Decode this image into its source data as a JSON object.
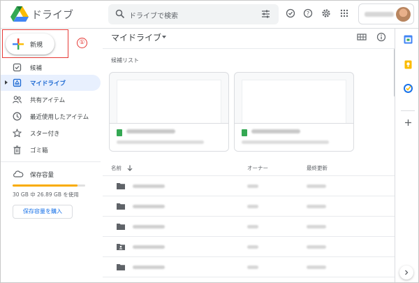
{
  "app": {
    "title": "ドライブ"
  },
  "search": {
    "placeholder": "ドライブで検索",
    "icon": "search-icon",
    "filter_icon": "tune-icon"
  },
  "header_icons": [
    "offline-check-icon",
    "help-icon",
    "settings-icon",
    "apps-grid-icon"
  ],
  "sidebar": {
    "new_button": "新規",
    "step_marker": "①",
    "items": [
      {
        "label": "候補",
        "icon": "priority-check-icon"
      },
      {
        "label": "マイドライブ",
        "icon": "my-drive-icon",
        "active": true
      },
      {
        "label": "共有アイテム",
        "icon": "shared-people-icon"
      },
      {
        "label": "最近使用したアイテム",
        "icon": "clock-icon"
      },
      {
        "label": "スター付き",
        "icon": "star-icon"
      },
      {
        "label": "ゴミ箱",
        "icon": "trash-icon"
      }
    ],
    "storage": {
      "label": "保存容量",
      "usage_text": "30 GB 中 26.89 GB を使用",
      "fill_fraction": 0.896,
      "buy_button": "保存容量を購入"
    }
  },
  "main": {
    "title": "マイドライブ",
    "suggested_label": "候補リスト",
    "columns": {
      "name": "名前",
      "owner": "オーナー",
      "modified": "最終更新"
    }
  },
  "colors": {
    "accent": "#1a73e8",
    "active_bg": "#e8f0fe",
    "storage_bar": "#f9ab00",
    "highlight": "#e53935"
  }
}
